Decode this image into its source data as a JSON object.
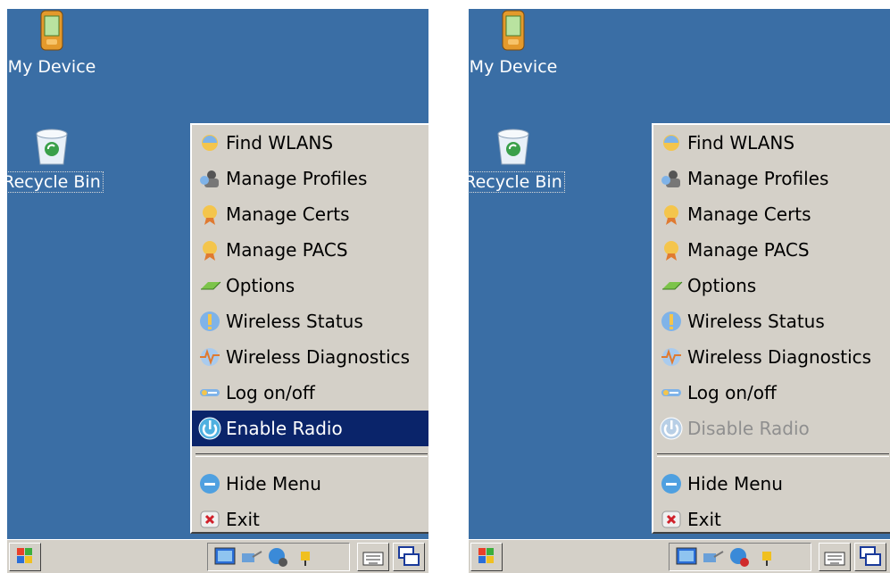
{
  "desktop": {
    "my_device_label": "My Device",
    "recycle_bin_label": "Recycle Bin",
    "background_color": "#3a6ea5"
  },
  "left_menu": {
    "items": [
      {
        "label": "Find WLANS",
        "icon": "find-wlans-icon"
      },
      {
        "label": "Manage Profiles",
        "icon": "manage-profiles-icon"
      },
      {
        "label": "Manage Certs",
        "icon": "manage-certs-icon"
      },
      {
        "label": "Manage PACS",
        "icon": "manage-pacs-icon"
      },
      {
        "label": "Options",
        "icon": "options-icon"
      },
      {
        "label": "Wireless Status",
        "icon": "wireless-status-icon"
      },
      {
        "label": "Wireless Diagnostics",
        "icon": "wireless-diagnostics-icon"
      },
      {
        "label": "Log on/off",
        "icon": "log-on-off-icon"
      },
      {
        "label": "Enable Radio",
        "icon": "power-icon",
        "state": "selected"
      }
    ],
    "bottom_items": [
      {
        "label": "Hide Menu",
        "icon": "hide-menu-icon"
      },
      {
        "label": "Exit",
        "icon": "exit-icon"
      }
    ],
    "selected_color": "#0a246a"
  },
  "right_menu": {
    "items": [
      {
        "label": "Find WLANS",
        "icon": "find-wlans-icon"
      },
      {
        "label": "Manage Profiles",
        "icon": "manage-profiles-icon"
      },
      {
        "label": "Manage Certs",
        "icon": "manage-certs-icon"
      },
      {
        "label": "Manage PACS",
        "icon": "manage-pacs-icon"
      },
      {
        "label": "Options",
        "icon": "options-icon"
      },
      {
        "label": "Wireless Status",
        "icon": "wireless-status-icon"
      },
      {
        "label": "Wireless Diagnostics",
        "icon": "wireless-diagnostics-icon"
      },
      {
        "label": "Log on/off",
        "icon": "log-on-off-icon"
      },
      {
        "label": "Disable Radio",
        "icon": "power-icon",
        "state": "disabled"
      }
    ],
    "bottom_items": [
      {
        "label": "Hide Menu",
        "icon": "hide-menu-icon"
      },
      {
        "label": "Exit",
        "icon": "exit-icon"
      }
    ]
  },
  "taskbar": {
    "start_icon": "windows-flag-icon",
    "tray_icons": [
      "desktop-icon",
      "network-icon",
      "radio-icon",
      "power-plug-icon"
    ],
    "keyboard_icon": "keyboard-icon",
    "switch_icon": "switch-windows-icon"
  }
}
